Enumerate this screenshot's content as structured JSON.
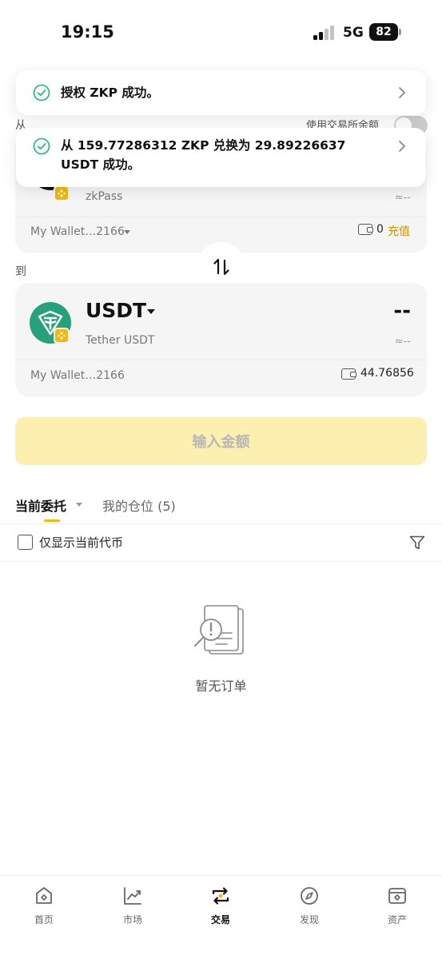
{
  "status_bar": {
    "time": "19:15",
    "network": "5G",
    "battery": "82"
  },
  "toasts": [
    {
      "text": "授权 ZKP 成功。",
      "icon": "check-circle-icon",
      "chevron": "chevron-right-icon"
    },
    {
      "line1": "从 159.77286312 ZKP 兑换为 29.89226637",
      "line2": "USDT 成功。",
      "icon": "check-circle-icon",
      "chevron": "chevron-right-icon"
    }
  ],
  "swap": {
    "from_label": "从",
    "to_label": "到",
    "use_balance_label": "使用交易所余额",
    "from": {
      "token_name": "zkPass",
      "approx_value": "≈--",
      "wallet": "My Wallet…2166",
      "balance": "0",
      "deposit_label": "充值"
    },
    "to": {
      "symbol": "USDT",
      "token_name": "Tether USDT",
      "amount": "--",
      "approx_value": "≈--",
      "wallet": "My Wallet…2166",
      "balance": "44.76856"
    },
    "swap_icon": "swap-vertical-icon",
    "cta_label": "输入金额"
  },
  "orders": {
    "tabs": [
      {
        "label": "当前委托",
        "active": true
      },
      {
        "label": "我的仓位 (5)",
        "active": false
      }
    ],
    "filter_current_only_label": "仅显示当前代币",
    "empty_text": "暂无订单"
  },
  "colors": {
    "accent": "#f0b90b",
    "cta_disabled_bg": "#fdefb0",
    "success_green": "#2ebd85",
    "usdt_teal": "#26a17b"
  },
  "bottom_nav": [
    {
      "label": "首页",
      "icon": "home-icon",
      "active": false
    },
    {
      "label": "市场",
      "icon": "market-chart-icon",
      "active": false
    },
    {
      "label": "交易",
      "icon": "trade-swap-icon",
      "active": true
    },
    {
      "label": "发现",
      "icon": "discover-compass-icon",
      "active": false
    },
    {
      "label": "资产",
      "icon": "wallet-assets-icon",
      "active": false
    }
  ]
}
